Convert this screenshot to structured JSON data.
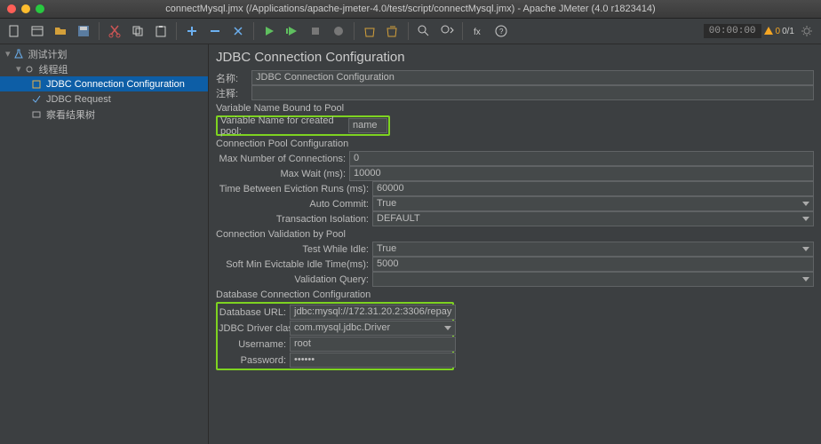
{
  "window": {
    "title": "connectMysql.jmx (/Applications/apache-jmeter-4.0/test/script/connectMysql.jmx) - Apache JMeter (4.0 r1823414)",
    "timer": "00:00:00",
    "warn_count": "0",
    "thread_counter": "0/1"
  },
  "tree": {
    "root": "测试计划",
    "thread_group": "线程组",
    "jdbc_config": "JDBC Connection Configuration",
    "jdbc_request": "JDBC Request",
    "view_results": "察看结果树"
  },
  "panel": {
    "title": "JDBC Connection Configuration",
    "name_label": "名称:",
    "name_value": "JDBC Connection Configuration",
    "comment_label": "注释:",
    "comment_value": "",
    "sec_pool": "Variable Name Bound to Pool",
    "var_name_label": "Variable Name for created pool:",
    "var_name_value": "name",
    "sec_conn_pool": "Connection Pool Configuration",
    "max_conn_label": "Max Number of Connections:",
    "max_conn_value": "0",
    "max_wait_label": "Max Wait (ms):",
    "max_wait_value": "10000",
    "evict_label": "Time Between Eviction Runs (ms):",
    "evict_value": "60000",
    "auto_commit_label": "Auto Commit:",
    "auto_commit_value": "True",
    "tx_iso_label": "Transaction Isolation:",
    "tx_iso_value": "DEFAULT",
    "sec_valid": "Connection Validation by Pool",
    "test_idle_label": "Test While Idle:",
    "test_idle_value": "True",
    "soft_min_label": "Soft Min Evictable Idle Time(ms):",
    "soft_min_value": "5000",
    "valid_query_label": "Validation Query:",
    "valid_query_value": "",
    "sec_db": "Database Connection Configuration",
    "db_url_label": "Database URL:",
    "db_url_value": "jdbc:mysql://172.31.20.2:3306/repay",
    "driver_label": "JDBC Driver class:",
    "driver_value": "com.mysql.jdbc.Driver",
    "user_label": "Username:",
    "user_value": "root",
    "pass_label": "Password:",
    "pass_value": "••••••"
  }
}
